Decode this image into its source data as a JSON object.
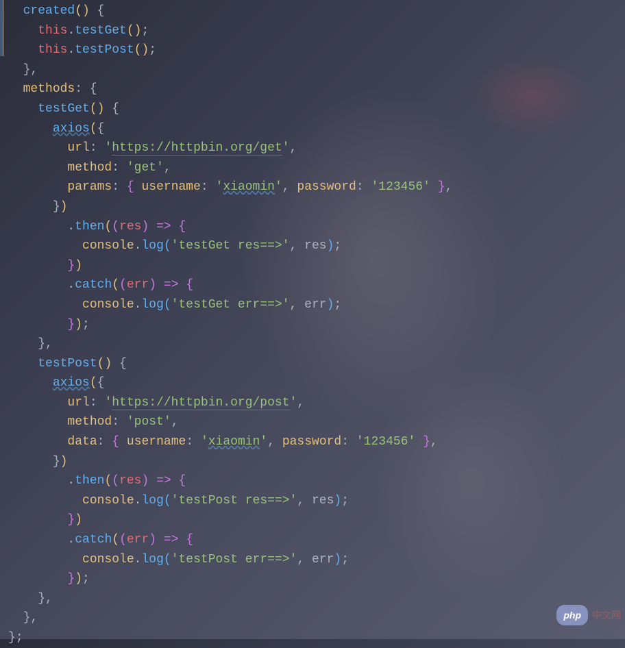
{
  "code": {
    "created_open": "created",
    "this1": "this",
    "testGet_call": "testGet",
    "this2": "this",
    "testPost_call": "testPost",
    "methods_label": "methods",
    "testGet_def": "testGet",
    "axios1": "axios",
    "url_label1": "url",
    "url_value1": "https://httpbin.org/get",
    "method_label1": "method",
    "method_value1": "get",
    "params_label": "params",
    "username_label1": "username",
    "username_value1": "xiaomin",
    "password_label1": "password",
    "password_value1": "123456",
    "then1": "then",
    "res1": "res",
    "console1": "console",
    "log1": "log",
    "testGet_res": "testGet res==>",
    "res1b": "res",
    "catch1": "catch",
    "err1": "err",
    "console2": "console",
    "log2": "log",
    "testGet_err": "testGet err==>",
    "err1b": "err",
    "testPost_def": "testPost",
    "axios2": "axios",
    "url_label2": "url",
    "url_value2": "https://httpbin.org/post",
    "method_label2": "method",
    "method_value2": "post",
    "data_label": "data",
    "username_label2": "username",
    "username_value2": "xiaomin",
    "password_label2": "password",
    "password_value2": "123456",
    "then2": "then",
    "res2": "res",
    "console3": "console",
    "log3": "log",
    "testPost_res": "testPost res==>",
    "res2b": "res",
    "catch2": "catch",
    "err2": "err",
    "console4": "console",
    "log4": "log",
    "testPost_err": "testPost err==>",
    "err2b": "err"
  },
  "watermark": {
    "badge": "php",
    "text": "中文网"
  }
}
